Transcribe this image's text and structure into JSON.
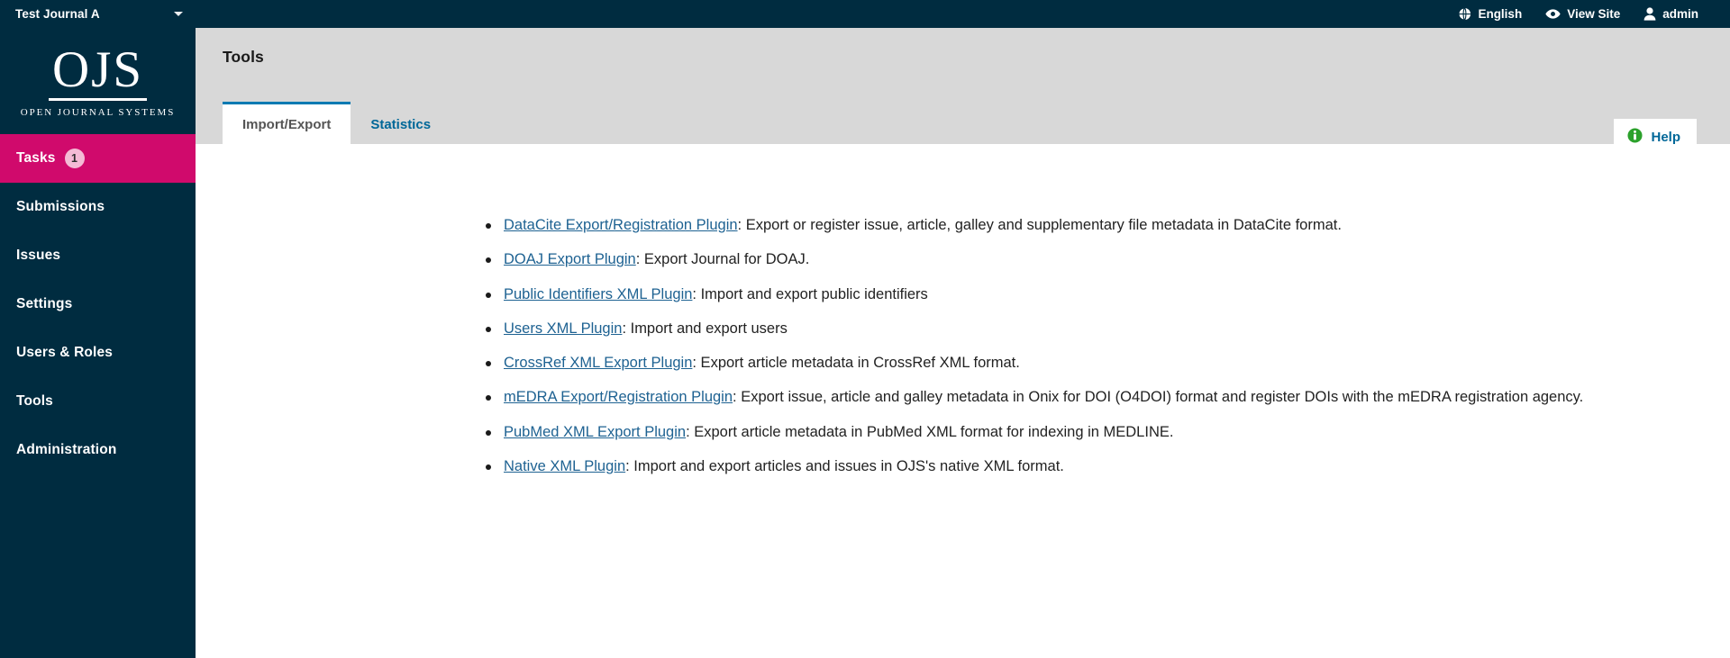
{
  "topbar": {
    "journal_name": "Test Journal A",
    "journal_switch_icon": "chevron-down-icon",
    "nav": [
      {
        "label": "English",
        "icon": "globe-icon"
      },
      {
        "label": "View Site",
        "icon": "eye-icon"
      },
      {
        "label": "admin",
        "icon": "user-icon"
      }
    ]
  },
  "sidebar": {
    "logo": {
      "wordmark": "OJS",
      "subtitle": "OPEN JOURNAL SYSTEMS"
    },
    "items": [
      {
        "label": "Tasks",
        "badge": "1",
        "active": true
      },
      {
        "label": "Submissions",
        "badge": null,
        "active": false
      },
      {
        "label": "Issues",
        "badge": null,
        "active": false
      },
      {
        "label": "Settings",
        "badge": null,
        "active": false
      },
      {
        "label": "Users & Roles",
        "badge": null,
        "active": false
      },
      {
        "label": "Tools",
        "badge": null,
        "active": false
      },
      {
        "label": "Administration",
        "badge": null,
        "active": false
      }
    ]
  },
  "page": {
    "title": "Tools",
    "tabs": [
      {
        "label": "Import/Export",
        "active": true
      },
      {
        "label": "Statistics",
        "active": false
      }
    ],
    "help": {
      "label": "Help",
      "icon": "info-circle-icon"
    }
  },
  "plugins": [
    {
      "name": "DataCite Export/Registration Plugin",
      "description": ": Export or register issue, article, galley and supplementary file metadata in DataCite format."
    },
    {
      "name": "DOAJ Export Plugin",
      "description": ": Export Journal for DOAJ."
    },
    {
      "name": "Public Identifiers XML Plugin",
      "description": ": Import and export public identifiers"
    },
    {
      "name": "Users XML Plugin",
      "description": ": Import and export users"
    },
    {
      "name": "CrossRef XML Export Plugin",
      "description": ": Export article metadata in CrossRef XML format."
    },
    {
      "name": "mEDRA Export/Registration Plugin",
      "description": ": Export issue, article and galley metadata in Onix for DOI (O4DOI) format and register DOIs with the mEDRA registration agency."
    },
    {
      "name": "PubMed XML Export Plugin",
      "description": ": Export article metadata in PubMed XML format for indexing in MEDLINE."
    },
    {
      "name": "Native XML Plugin",
      "description": ": Import and export articles and issues in OJS's native XML format."
    }
  ],
  "colors": {
    "sidebar_bg": "#002c40",
    "tasks_accent": "#d00a6c",
    "badge_bg": "#f4bbd5",
    "page_head_bg": "#d8d8d8",
    "tab_active_border": "#007ab2",
    "link": "#1e6292",
    "help_icon": "#2ba12b"
  }
}
